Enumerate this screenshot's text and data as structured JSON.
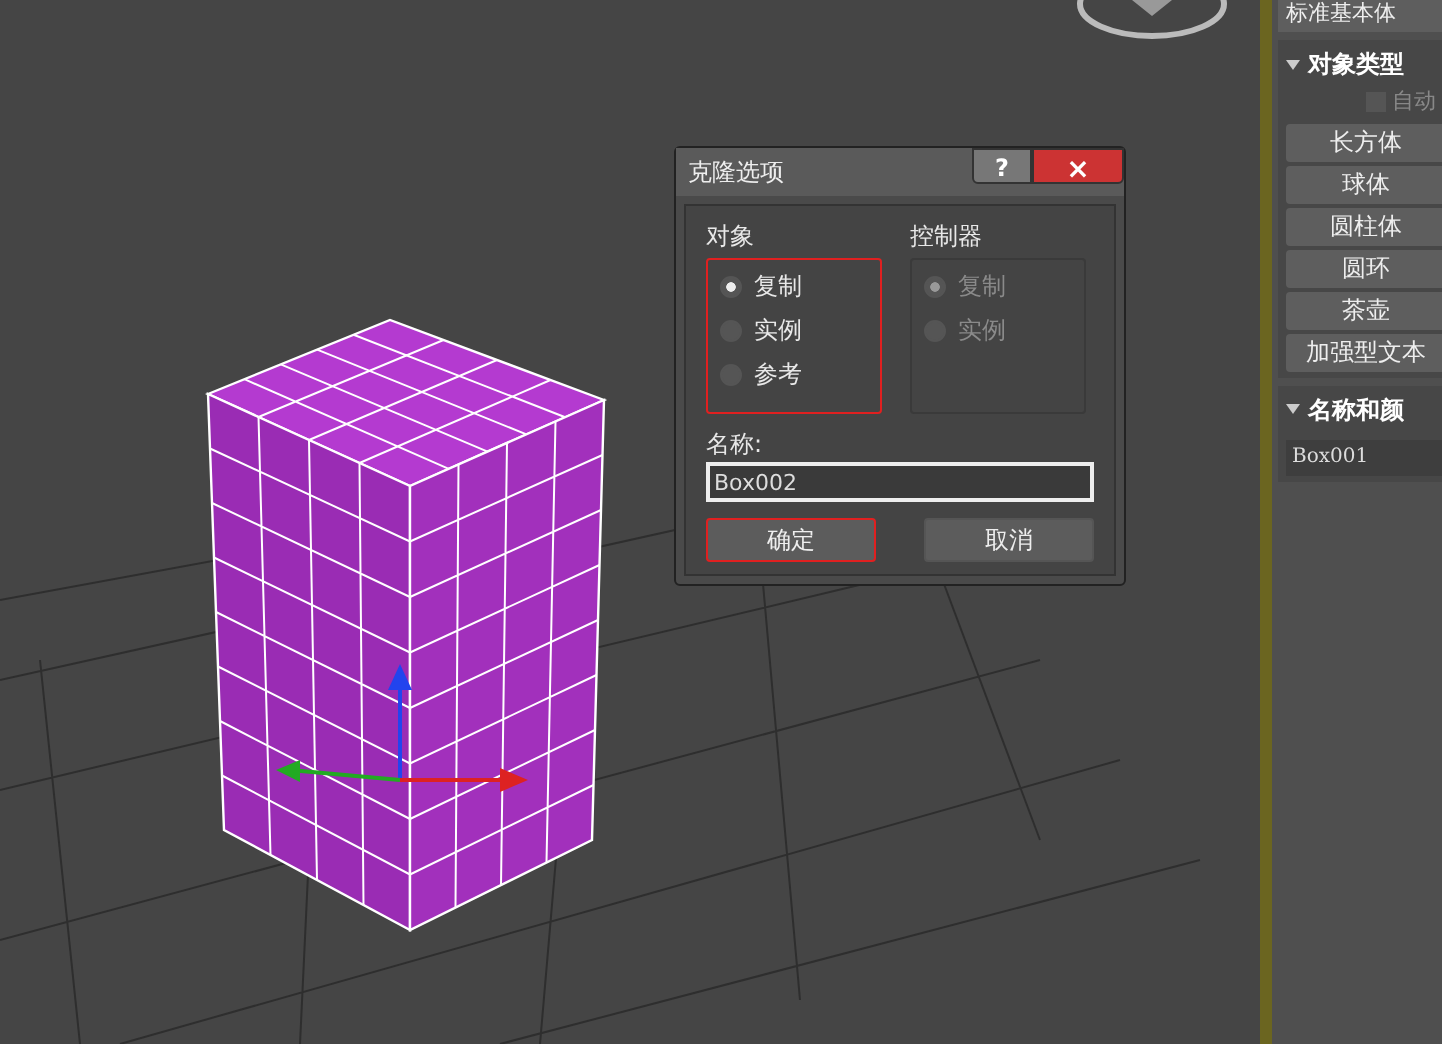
{
  "dialog": {
    "title": "克隆选项",
    "help_button": "?",
    "close_button": "×",
    "groups": [
      {
        "title": "对象",
        "disabled": false,
        "highlighted": true,
        "options": [
          {
            "label": "复制",
            "selected": true
          },
          {
            "label": "实例",
            "selected": false
          },
          {
            "label": "参考",
            "selected": false
          }
        ]
      },
      {
        "title": "控制器",
        "disabled": true,
        "highlighted": false,
        "options": [
          {
            "label": "复制",
            "selected": true
          },
          {
            "label": "实例",
            "selected": false
          }
        ]
      }
    ],
    "name_label": "名称:",
    "name_value": "Box002",
    "buttons": [
      {
        "label": "确定",
        "highlighted": true
      },
      {
        "label": "取消",
        "highlighted": false
      }
    ]
  },
  "command_panel": {
    "dropdown": "标准基本体",
    "object_type": {
      "title": "对象类型",
      "expanded": true,
      "autogrid": {
        "label": "自动",
        "checked": false
      },
      "buttons": [
        "长方体",
        "球体",
        "圆柱体",
        "圆环",
        "茶壶",
        "加强型文本"
      ]
    },
    "name_and_color": {
      "title": "名称和颜",
      "expanded": true,
      "name_value": "Box001"
    }
  }
}
